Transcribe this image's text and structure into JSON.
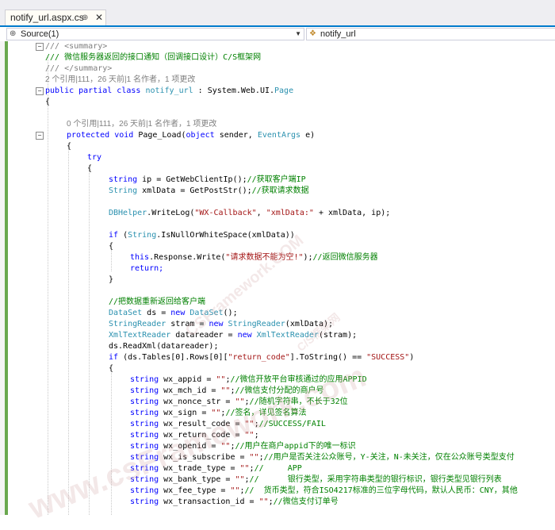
{
  "tabs": [
    {
      "label": "notify_url.aspx.cs",
      "pin": "⊕",
      "close": "✕"
    }
  ],
  "nav": {
    "left_dropdown": "Source(1)",
    "right_dropdown": "notify_url"
  },
  "watermarks": [
    "CSFramework.COM",
    "C/S框架网",
    "www.csFramework.com"
  ],
  "code": [
    "/// <summary>",
    "/// 微信服务器返回的接口通知（回调接口设计）C/S框架网",
    "/// </summary>",
    "2 个引用|111，26 天前|1 名作者，1 项更改",
    "public partial class notify_url : System.Web.UI.Page",
    "{",
    "",
    "0 个引用|111，26 天前|1 名作者，1 项更改",
    "protected void Page_Load(object sender, EventArgs e)",
    "{",
    "try",
    "{",
    "string ip = GetWebClientIp();//获取客户端IP",
    "String xmlData = GetPostStr();//获取请求数据",
    "",
    "DBHelper.WriteLog(\"WX-Callback\", \"xmlData:\" + xmlData, ip);",
    "",
    "if (String.IsNullOrWhiteSpace(xmlData))",
    "{",
    "this.Response.Write(\"请求数据不能为空!\");//返回微信服务器",
    "return;",
    "}",
    "",
    "//把数据重新返回给客户端",
    "DataSet ds = new DataSet();",
    "StringReader stram = new StringReader(xmlData);",
    "XmlTextReader datareader = new XmlTextReader(stram);",
    "ds.ReadXml(datareader);",
    "if (ds.Tables[0].Rows[0][\"return_code\"].ToString() == \"SUCCESS\")",
    "{",
    "string wx_appid = \"\";//微信开放平台审核通过的应用APPID",
    "string wx_mch_id = \"\";//微信支付分配的商户号",
    "string wx_nonce_str = \"\";//随机字符串，不长于32位",
    "string wx_sign = \"\";//签名，详见签名算法",
    "string wx_result_code = \"\";//SUCCESS/FAIL",
    "string wx_return_code = \"\";",
    "string wx_openid = \"\";//用户在商户appid下的唯一标识",
    "string wx_is_subscribe = \"\";//用户是否关注公众账号，Y-关注，N-未关注，仅在公众账号类型支付",
    "string wx_trade_type = \"\";//     APP",
    "string wx_bank_type = \"\";//      银行类型，采用字符串类型的银行标识，银行类型见银行列表",
    "string wx_fee_type = \"\";//  货币类型，符合ISO4217标准的三位字母代码，默认人民币：CNY，其他",
    "string wx_transaction_id = \"\";//微信支付订单号"
  ]
}
